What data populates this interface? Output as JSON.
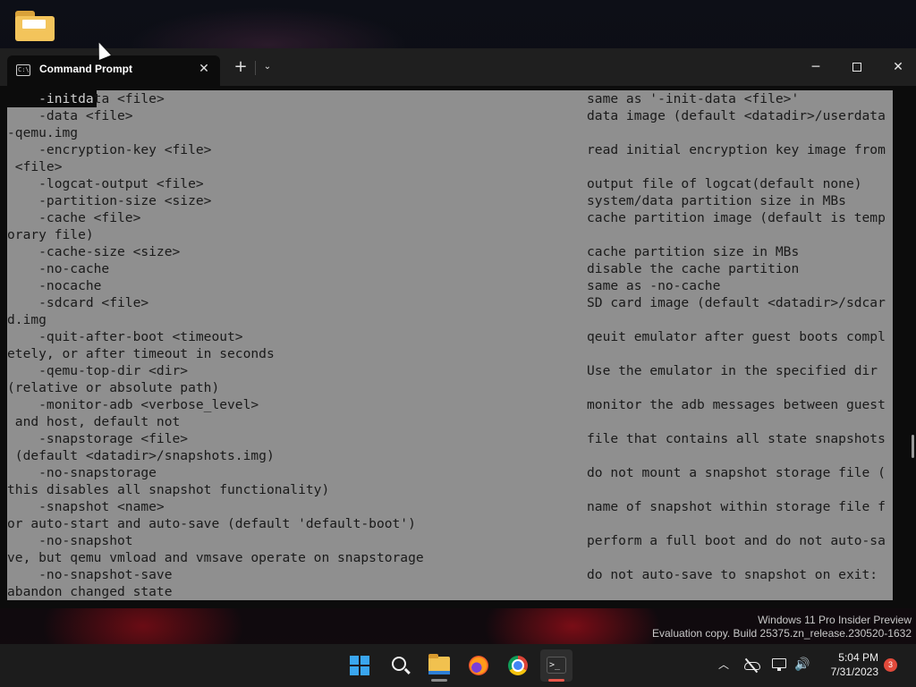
{
  "window": {
    "tab_title": "Command Prompt",
    "tab_close": "✕",
    "new_tab": "+",
    "dropdown": "⌄",
    "minimize": "─",
    "close": "✕"
  },
  "console_lines": [
    {
      "left": "    -initdata <file>",
      "right": "same as '-init-data <file>'"
    },
    {
      "left": "    -data <file>",
      "right": "data image (default <datadir>/userdata"
    },
    {
      "left": "-qemu.img",
      "right": ""
    },
    {
      "left": "    -encryption-key <file>",
      "right": "read initial encryption key image from"
    },
    {
      "left": " <file>",
      "right": ""
    },
    {
      "left": "    -logcat-output <file>",
      "right": "output file of logcat(default none)"
    },
    {
      "left": "    -partition-size <size>",
      "right": "system/data partition size in MBs"
    },
    {
      "left": "    -cache <file>",
      "right": "cache partition image (default is temp"
    },
    {
      "left": "orary file)",
      "right": ""
    },
    {
      "left": "    -cache-size <size>",
      "right": "cache partition size in MBs"
    },
    {
      "left": "    -no-cache",
      "right": "disable the cache partition"
    },
    {
      "left": "    -nocache",
      "right": "same as -no-cache"
    },
    {
      "left": "    -sdcard <file>",
      "right": "SD card image (default <datadir>/sdcar"
    },
    {
      "left": "d.img",
      "right": ""
    },
    {
      "left": "    -quit-after-boot <timeout>",
      "right": "qeuit emulator after guest boots compl"
    },
    {
      "left": "etely, or after timeout in seconds",
      "right": ""
    },
    {
      "left": "    -qemu-top-dir <dir>",
      "right": "Use the emulator in the specified dir"
    },
    {
      "left": "(relative or absolute path)",
      "right": ""
    },
    {
      "left": "    -monitor-adb <verbose_level>",
      "right": "monitor the adb messages between guest"
    },
    {
      "left": " and host, default not",
      "right": ""
    },
    {
      "left": "    -snapstorage <file>",
      "right": "file that contains all state snapshots"
    },
    {
      "left": " (default <datadir>/snapshots.img)",
      "right": ""
    },
    {
      "left": "    -no-snapstorage",
      "right": "do not mount a snapshot storage file ("
    },
    {
      "left": "this disables all snapshot functionality)",
      "right": ""
    },
    {
      "left": "    -snapshot <name>",
      "right": "name of snapshot within storage file f"
    },
    {
      "left": "or auto-start and auto-save (default 'default-boot')",
      "right": ""
    },
    {
      "left": "    -no-snapshot",
      "right": "perform a full boot and do not auto-sa"
    },
    {
      "left": "ve, but qemu vmload and vmsave operate on snapstorage",
      "right": ""
    },
    {
      "left": "    -no-snapshot-save",
      "right": "do not auto-save to snapshot on exit:"
    },
    {
      "left": "abandon changed state",
      "right": ""
    }
  ],
  "watermark": {
    "line1": "Windows 11 Pro Insider Preview",
    "line2": "Evaluation copy. Build 25375.zn_release.230520-1632"
  },
  "taskbar": {
    "tray_chevron": "︿",
    "volume_glyph": "🔊",
    "time": "5:04 PM",
    "date": "7/31/2023",
    "notification_count": "3"
  },
  "colors": {
    "selection": "#8f8f8f",
    "console_bg": "#0c0c0c",
    "taskbar_bg": "#1c1c1c",
    "accent": "#3aa6f0",
    "badge": "#e24a3b"
  }
}
